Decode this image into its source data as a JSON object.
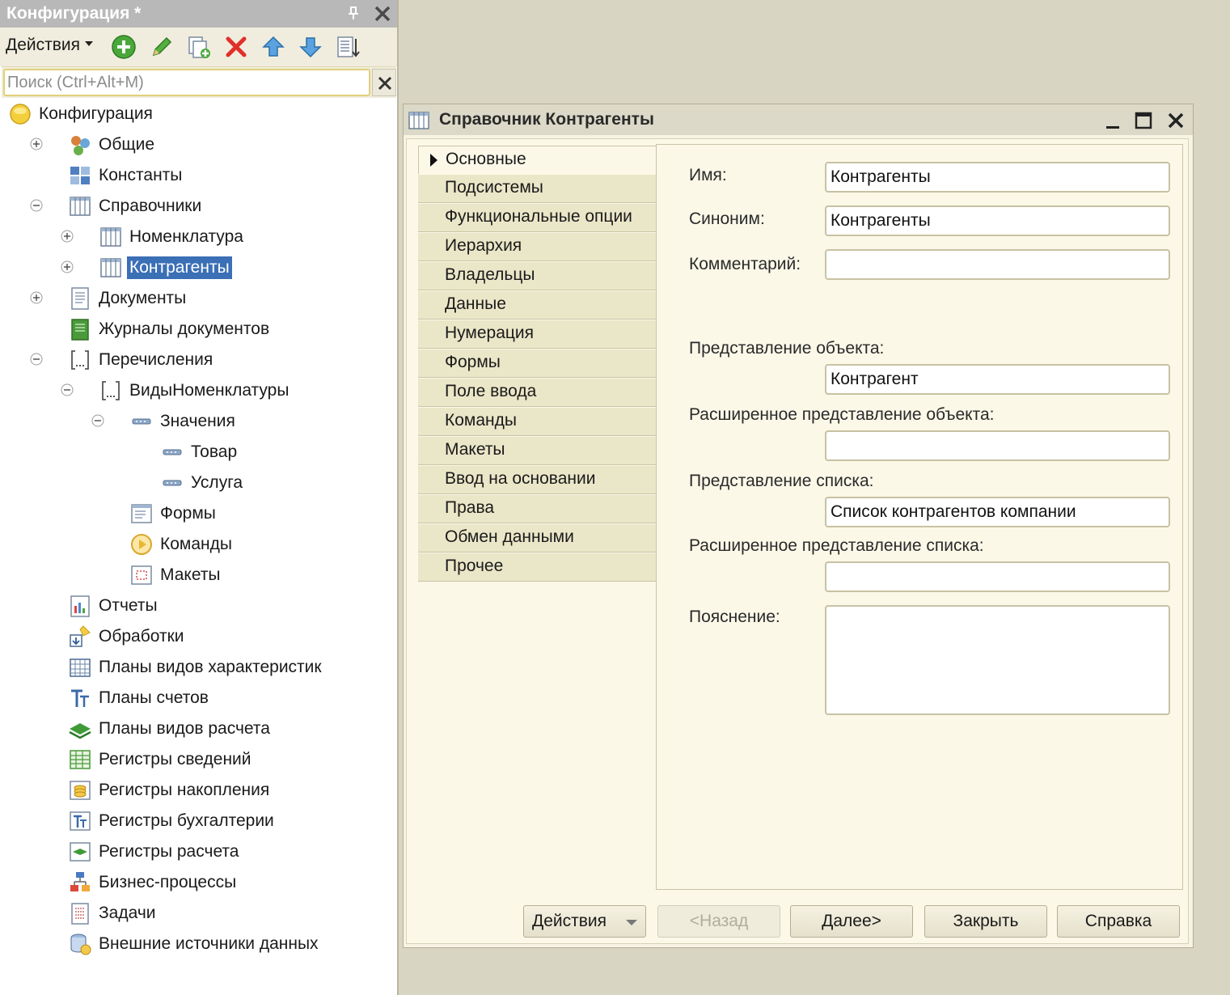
{
  "left_panel": {
    "title": "Конфигурация *",
    "actions_label": "Действия",
    "search_placeholder": "Поиск (Ctrl+Alt+M)",
    "tree": [
      {
        "label": "Конфигурация"
      },
      {
        "label": "Общие"
      },
      {
        "label": "Константы"
      },
      {
        "label": "Справочники"
      },
      {
        "label": "Номенклатура"
      },
      {
        "label": "Контрагенты",
        "selected": true
      },
      {
        "label": "Документы"
      },
      {
        "label": "Журналы документов"
      },
      {
        "label": "Перечисления"
      },
      {
        "label": "ВидыНоменклатуры"
      },
      {
        "label": "Значения"
      },
      {
        "label": "Товар"
      },
      {
        "label": "Услуга"
      },
      {
        "label": "Формы"
      },
      {
        "label": "Команды"
      },
      {
        "label": "Макеты"
      },
      {
        "label": "Отчеты"
      },
      {
        "label": "Обработки"
      },
      {
        "label": "Планы видов характеристик"
      },
      {
        "label": "Планы счетов"
      },
      {
        "label": "Планы видов расчета"
      },
      {
        "label": "Регистры сведений"
      },
      {
        "label": "Регистры накопления"
      },
      {
        "label": "Регистры бухгалтерии"
      },
      {
        "label": "Регистры расчета"
      },
      {
        "label": "Бизнес-процессы"
      },
      {
        "label": "Задачи"
      },
      {
        "label": "Внешние источники данных"
      }
    ]
  },
  "window": {
    "title": "Справочник Контрагенты",
    "nav_tabs": [
      {
        "label": "Основные",
        "active": true
      },
      {
        "label": "Подсистемы"
      },
      {
        "label": "Функциональные опции"
      },
      {
        "label": "Иерархия"
      },
      {
        "label": "Владельцы"
      },
      {
        "label": "Данные"
      },
      {
        "label": "Нумерация"
      },
      {
        "label": "Формы"
      },
      {
        "label": "Поле ввода"
      },
      {
        "label": "Команды"
      },
      {
        "label": "Макеты"
      },
      {
        "label": "Ввод на основании"
      },
      {
        "label": "Права"
      },
      {
        "label": "Обмен данными"
      },
      {
        "label": "Прочее"
      }
    ],
    "fields": {
      "name_label": "Имя:",
      "name_value": "Контрагенты",
      "synonym_label": "Синоним:",
      "synonym_value": "Контрагенты",
      "comment_label": "Комментарий:",
      "comment_value": "",
      "object_repr_label": "Представление объекта:",
      "object_repr_value": "Контрагент",
      "ext_object_repr_label": "Расширенное представление объекта:",
      "ext_object_repr_value": "",
      "list_repr_label": "Представление списка:",
      "list_repr_value": "Список контрагентов компании",
      "ext_list_repr_label": "Расширенное представление списка:",
      "ext_list_repr_value": "",
      "explanation_label": "Пояснение:",
      "explanation_value": ""
    },
    "buttons": {
      "actions": "Действия",
      "back": "<Назад",
      "next": "Далее>",
      "close": "Закрыть",
      "help": "Справка"
    }
  },
  "colors": {
    "selection": "#3b6fb6",
    "titlebar_inactive": "#b8b8b8",
    "workspace": "#d8d5c3",
    "tab_bg": "#eae6c8"
  }
}
